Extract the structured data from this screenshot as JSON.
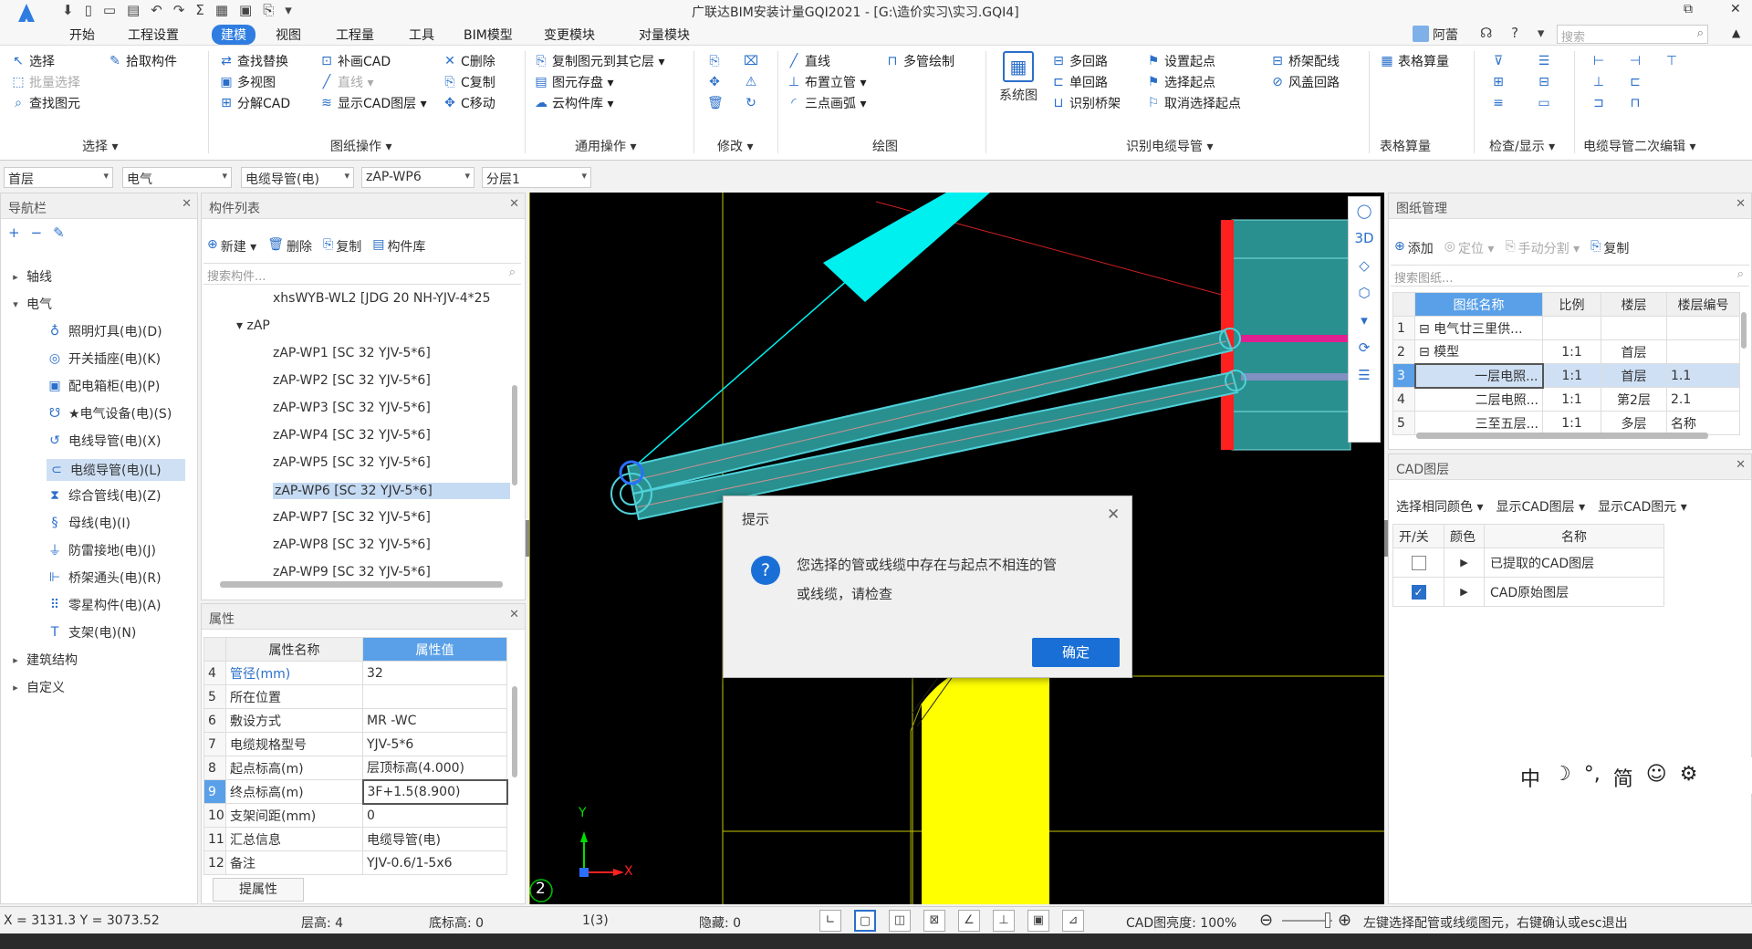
{
  "window": {
    "title": "广联达BIM安装计量GQI2021 - [G:\\造价实习\\实习.GQI4]",
    "user": "阿蕾",
    "search_placeholder": "搜索",
    "controls": [
      "?",
      "▲",
      "⬚",
      "—"
    ]
  },
  "quick_access": [
    "⬇",
    "▯",
    "▭",
    "▤",
    "↶",
    "↷",
    "Σ",
    "▦",
    "▣",
    "⎘",
    "▾"
  ],
  "menu": {
    "items": [
      "开始",
      "工程设置",
      "建模",
      "视图",
      "工程量",
      "工具",
      "BIM模型",
      "变更模块",
      "对量模块"
    ],
    "active": "建模"
  },
  "ribbon": {
    "groups": [
      {
        "label": "选择 ▾",
        "buttons": [
          {
            "icon": "↖",
            "label": "选择"
          },
          {
            "icon": "⬚",
            "label": "批量选择",
            "disabled": true
          },
          {
            "icon": "⌕",
            "label": "查找图元"
          },
          {
            "icon": "✎",
            "label": "拾取构件"
          }
        ]
      },
      {
        "label": "图纸操作 ▾",
        "buttons": [
          {
            "icon": "⇄",
            "label": "查找替换"
          },
          {
            "icon": "▣",
            "label": "多视图"
          },
          {
            "icon": "⊞",
            "label": "分解CAD"
          },
          {
            "icon": "⊡",
            "label": "补画CAD"
          },
          {
            "icon": "╱",
            "label": "直线 ▾",
            "disabled": true
          },
          {
            "icon": "≋",
            "label": "显示CAD图层 ▾"
          },
          {
            "icon": "✕",
            "label": "C删除"
          },
          {
            "icon": "⎘",
            "label": "C复制"
          },
          {
            "icon": "✥",
            "label": "C移动"
          }
        ]
      },
      {
        "label": "通用操作 ▾",
        "buttons": [
          {
            "icon": "⎘",
            "label": "复制图元到其它层 ▾"
          },
          {
            "icon": "▤",
            "label": "图元存盘 ▾"
          },
          {
            "icon": "☁",
            "label": "云构件库 ▾"
          }
        ]
      },
      {
        "label": "修改 ▾",
        "buttons": [
          {
            "icon": "⎘",
            "label": ""
          },
          {
            "icon": "⌧",
            "label": ""
          },
          {
            "icon": "✥",
            "label": ""
          },
          {
            "icon": "⚠",
            "label": ""
          },
          {
            "icon": "🗑",
            "label": ""
          },
          {
            "icon": "↻",
            "label": ""
          }
        ]
      },
      {
        "label": "绘图",
        "buttons": [
          {
            "icon": "╱",
            "label": "直线"
          },
          {
            "icon": "⊥",
            "label": "布置立管 ▾"
          },
          {
            "icon": "◜",
            "label": "三点画弧 ▾"
          },
          {
            "icon": "⊓",
            "label": "多管绘制"
          }
        ]
      },
      {
        "label": "识别电缆导管 ▾",
        "buttons": [
          {
            "icon": "▦",
            "label": "系统图"
          },
          {
            "icon": "⊟",
            "label": "多回路"
          },
          {
            "icon": "⊏",
            "label": "单回路"
          },
          {
            "icon": "⊔",
            "label": "识别桥架"
          },
          {
            "icon": "⚑",
            "label": "设置起点"
          },
          {
            "icon": "⚑",
            "label": "选择起点"
          },
          {
            "icon": "⚐",
            "label": "取消选择起点"
          },
          {
            "icon": "⊟",
            "label": "桥架配线"
          },
          {
            "icon": "⊘",
            "label": "风盖回路"
          }
        ]
      },
      {
        "label": "表格算量",
        "buttons": [
          {
            "icon": "▦",
            "label": "表格算量"
          }
        ]
      },
      {
        "label": "检查/显示 ▾",
        "buttons": [
          {
            "icon": "⊽",
            "label": ""
          },
          {
            "icon": "☰",
            "label": ""
          },
          {
            "icon": "⊞",
            "label": ""
          },
          {
            "icon": "⊟",
            "label": ""
          },
          {
            "icon": "≡",
            "label": ""
          },
          {
            "icon": "▭",
            "label": ""
          }
        ]
      },
      {
        "label": "电缆导管二次编辑 ▾",
        "buttons": [
          {
            "icon": "⊢",
            "label": ""
          },
          {
            "icon": "⊣",
            "label": ""
          },
          {
            "icon": "⊤",
            "label": ""
          },
          {
            "icon": "⊥",
            "label": ""
          },
          {
            "icon": "⊏",
            "label": ""
          },
          {
            "icon": "⊐",
            "label": ""
          },
          {
            "icon": "⊓",
            "label": ""
          },
          {
            "icon": "⊔",
            "label": ""
          },
          {
            "icon": "⊡",
            "label": ""
          }
        ]
      }
    ]
  },
  "selectors": [
    "首层",
    "电气",
    "电缆导管(电)",
    "zAP-WP6",
    "分层1"
  ],
  "nav": {
    "title": "导航栏",
    "tools": [
      "+",
      "−",
      "✎"
    ],
    "items": [
      {
        "label": "轴线",
        "level": 0,
        "icon": "▸"
      },
      {
        "label": "电气",
        "level": 0,
        "icon": "▾"
      },
      {
        "label": "照明灯具(电)(D)",
        "level": 1,
        "icon": "♁"
      },
      {
        "label": "开关插座(电)(K)",
        "level": 1,
        "icon": "◎"
      },
      {
        "label": "配电箱柜(电)(P)",
        "level": 1,
        "icon": "▣"
      },
      {
        "label": "★电气设备(电)(S)",
        "level": 1,
        "icon": "☋"
      },
      {
        "label": "电线导管(电)(X)",
        "level": 1,
        "icon": "↺"
      },
      {
        "label": "电缆导管(电)(L)",
        "level": 1,
        "icon": "⊂",
        "selected": true
      },
      {
        "label": "综合管线(电)(Z)",
        "level": 1,
        "icon": "⧗"
      },
      {
        "label": "母线(电)(I)",
        "level": 1,
        "icon": "§"
      },
      {
        "label": "防雷接地(电)(J)",
        "level": 1,
        "icon": "⏚"
      },
      {
        "label": "桥架通头(电)(R)",
        "level": 1,
        "icon": "⊩"
      },
      {
        "label": "零星构件(电)(A)",
        "level": 1,
        "icon": "⠿"
      },
      {
        "label": "支架(电)(N)",
        "level": 1,
        "icon": "T"
      },
      {
        "label": "建筑结构",
        "level": 0,
        "icon": "▸"
      },
      {
        "label": "自定义",
        "level": 0,
        "icon": "▸"
      }
    ]
  },
  "component_list": {
    "title": "构件列表",
    "tools": [
      {
        "icon": "⊕",
        "label": "新建 ▾"
      },
      {
        "icon": "🗑",
        "label": "删除"
      },
      {
        "icon": "⎘",
        "label": "复制"
      },
      {
        "icon": "▤",
        "label": "构件库"
      }
    ],
    "search_placeholder": "搜索构件...",
    "rows": [
      {
        "label": "xhsWYB-WL2 [JDG 20 NH-YJV-4*25",
        "indent": 2
      },
      {
        "label": "▾ zAP",
        "indent": 1
      },
      {
        "label": "zAP-WP1 [SC 32 YJV-5*6]",
        "indent": 2
      },
      {
        "label": "zAP-WP2 [SC 32 YJV-5*6]",
        "indent": 2
      },
      {
        "label": "zAP-WP3 [SC 32 YJV-5*6]",
        "indent": 2
      },
      {
        "label": "zAP-WP4 [SC 32 YJV-5*6]",
        "indent": 2
      },
      {
        "label": "zAP-WP5 [SC 32 YJV-5*6]",
        "indent": 2
      },
      {
        "label": "zAP-WP6 [SC 32 YJV-5*6]",
        "indent": 2,
        "selected": true
      },
      {
        "label": "zAP-WP7 [SC 32 YJV-5*6]",
        "indent": 2
      },
      {
        "label": "zAP-WP8 [SC 32 YJV-5*6]",
        "indent": 2
      },
      {
        "label": "zAP-WP9 [SC 32 YJV-5*6]",
        "indent": 2
      }
    ]
  },
  "properties": {
    "title": "属性",
    "headers": [
      "属性名称",
      "属性值"
    ],
    "rows": [
      {
        "no": "4",
        "name": "管径(mm)",
        "value": "32",
        "blue": true
      },
      {
        "no": "5",
        "name": "所在位置",
        "value": ""
      },
      {
        "no": "6",
        "name": "敷设方式",
        "value": "MR -WC"
      },
      {
        "no": "7",
        "name": "电缆规格型号",
        "value": "YJV-5*6"
      },
      {
        "no": "8",
        "name": "起点标高(m)",
        "value": "层顶标高(4.000)"
      },
      {
        "no": "9",
        "name": "终点标高(m)",
        "value": "3F+1.5(8.900)",
        "selected": true
      },
      {
        "no": "10",
        "name": "支架间距(mm)",
        "value": "0"
      },
      {
        "no": "11",
        "name": "汇总信息",
        "value": "电缆导管(电)"
      },
      {
        "no": "12",
        "name": "备注",
        "value": "YJV-0.6/1-5x6"
      }
    ],
    "button": "提属性"
  },
  "canvas": {
    "axis_x": "X",
    "axis_y": "Y",
    "marker": "2"
  },
  "view_tools": [
    "◯",
    "3D",
    "◇",
    "⬡",
    "▾",
    "⟳",
    "☰"
  ],
  "dialog": {
    "title": "提示",
    "message_line1": "您选择的管或线缆中存在与起点不相连的管",
    "message_line2": "或线缆，请检查",
    "ok": "确定",
    "icon": "?"
  },
  "drawing_mgmt": {
    "title": "图纸管理",
    "tools": [
      {
        "icon": "⊕",
        "label": "添加"
      },
      {
        "icon": "◎",
        "label": "定位 ▾",
        "disabled": true
      },
      {
        "icon": "⎘",
        "label": "手动分割 ▾",
        "disabled": true
      },
      {
        "icon": "⎘",
        "label": "复制"
      }
    ],
    "search_placeholder": "搜索图纸...",
    "headers": [
      "图纸名称",
      "比例",
      "楼层",
      "楼层编号"
    ],
    "rows": [
      {
        "no": "1",
        "name": "⊟ 电气廿三里供...",
        "scale": "",
        "floor": "",
        "code": ""
      },
      {
        "no": "2",
        "name": "⊟ 模型",
        "scale": "1:1",
        "floor": "首层",
        "code": ""
      },
      {
        "no": "3",
        "name": "一层电照...",
        "scale": "1:1",
        "floor": "首层",
        "code": "1.1",
        "selected": true
      },
      {
        "no": "4",
        "name": "二层电照...",
        "scale": "1:1",
        "floor": "第2层",
        "code": "2.1"
      },
      {
        "no": "5",
        "name": "三至五层...",
        "scale": "1:1",
        "floor": "多层",
        "code": "名称"
      }
    ]
  },
  "cad_layers": {
    "title": "CAD图层",
    "tools": [
      "选择相同颜色 ▾",
      "显示CAD图层 ▾",
      "显示CAD图元 ▾"
    ],
    "headers": [
      "开/关",
      "颜色",
      "名称"
    ],
    "rows": [
      {
        "on": false,
        "name": "已提取的CAD图层"
      },
      {
        "on": true,
        "name": "CAD原始图层"
      }
    ]
  },
  "ime_bar": [
    "中",
    "☽",
    "°,",
    "简",
    "☺",
    "⚙"
  ],
  "status": {
    "coords": "X = 3131.3 Y = 3073.52",
    "floor_height": "层高: 4",
    "base_elevation": "底标高: 0",
    "count": "1(3)",
    "hidden": "隐藏: 0",
    "cad_brightness": "CAD图亮度: 100%",
    "hint": "左键选择配管或线缆图元，右键确认或esc退出",
    "tools": [
      "∟",
      "▢",
      "◫",
      "⊠",
      "∠",
      "⊥",
      "▣",
      "⊿"
    ],
    "zoom_minus": "⊖",
    "zoom_plus": "⊕"
  },
  "colors": {
    "accent": "#2f7de1",
    "canvas_bg": "#000000",
    "pipe": "#4fd1d9",
    "panel_fill": "#2a8f8f",
    "red_bar": "#ff2020",
    "yellow": "#ffff00",
    "cyan": "#00f0f0"
  }
}
